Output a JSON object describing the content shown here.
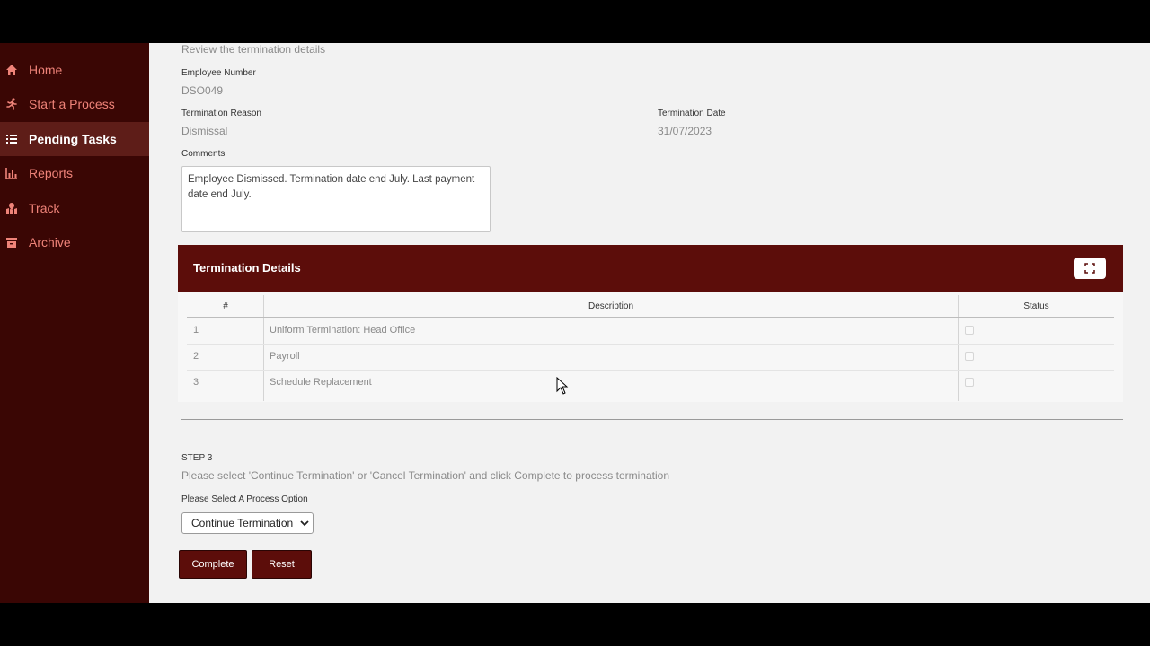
{
  "sidebar": {
    "items": [
      {
        "label": "Home",
        "icon": "home-icon"
      },
      {
        "label": "Start a Process",
        "icon": "running-icon"
      },
      {
        "label": "Pending Tasks",
        "icon": "list-icon",
        "active": true
      },
      {
        "label": "Reports",
        "icon": "bar-chart-icon"
      },
      {
        "label": "Track",
        "icon": "map-icon"
      },
      {
        "label": "Archive",
        "icon": "archive-icon"
      }
    ]
  },
  "review": {
    "intro": "Review the termination details",
    "employee_number_label": "Employee Number",
    "employee_number": "DSO049",
    "reason_label": "Termination Reason",
    "reason": "Dismissal",
    "date_label": "Termination Date",
    "date": "31/07/2023",
    "comments_label": "Comments",
    "comments": "Employee Dismissed. Termination date end July. Last payment date end July."
  },
  "details": {
    "title": "Termination Details",
    "columns": [
      "#",
      "Description",
      "Status"
    ],
    "rows": [
      {
        "num": "1",
        "description": "Uniform Termination: Head Office",
        "checked": false
      },
      {
        "num": "2",
        "description": "Payroll",
        "checked": false
      },
      {
        "num": "3",
        "description": "Schedule Replacement",
        "checked": false
      }
    ]
  },
  "step": {
    "title": "STEP 3",
    "instruction": "Please select 'Continue Termination' or 'Cancel Termination' and click Complete to process termination",
    "select_label": "Please Select A Process Option",
    "selected_option": "Continue Termination"
  },
  "buttons": {
    "complete": "Complete",
    "reset": "Reset"
  },
  "colors": {
    "sidebar_bg": "#3a0604",
    "sidebar_active": "#5e1d18",
    "sidebar_text": "#ef8379",
    "accent": "#5c0d0a"
  }
}
